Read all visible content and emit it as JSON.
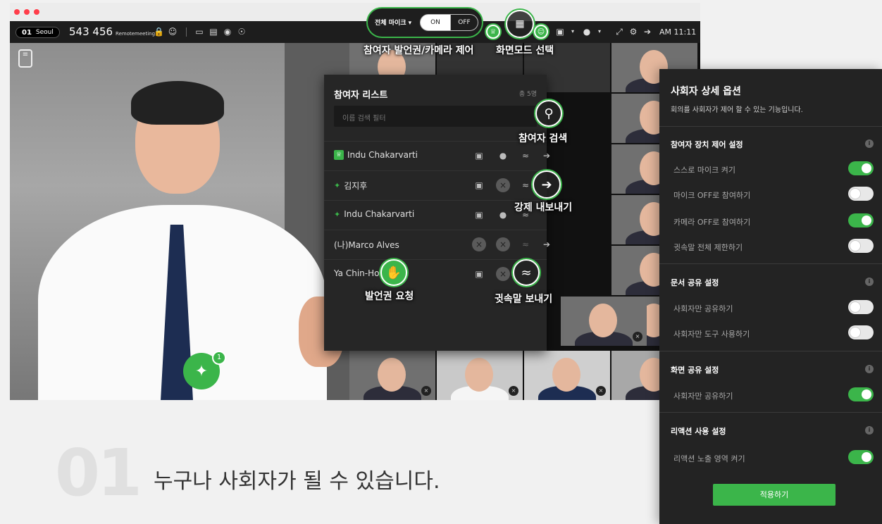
{
  "topbar": {
    "location_num": "01",
    "location": "Seoul",
    "room_id": "543 456",
    "room_name": "Remotemeeting",
    "time": "AM 11:11"
  },
  "mic_control": {
    "label": "전체 마이크 ▾",
    "on": "ON",
    "off": "OFF"
  },
  "participants_panel": {
    "title": "참여자 리스트",
    "count": "총 5명",
    "search_placeholder": "이름 검색 필터",
    "rows": [
      {
        "name": "Indu Chakarvarti",
        "role": "host"
      },
      {
        "name": "김지후",
        "role": "pinned"
      },
      {
        "name": "Indu Chakarvarti",
        "role": "pinned"
      },
      {
        "name": "(나)Marco Alves",
        "role": "self"
      },
      {
        "name": "Ya Chin-Ho",
        "role": "member"
      }
    ]
  },
  "callouts": {
    "participant_control": "참여자 발언권/카메라 제어",
    "screen_mode": "화면모드 선택",
    "search": "참여자 검색",
    "kick": "강제 내보내기",
    "speak_request": "발언권 요청",
    "whisper": "귓속말 보내기"
  },
  "pin_badge_count": "1",
  "host_options": {
    "title": "사회자 상세 옵션",
    "description": "회의를 사회자가 제어 할 수 있는 기능입니다.",
    "sections": [
      {
        "title": "참여자 장치 제어 설정",
        "options": [
          {
            "label": "스스로 마이크 켜기",
            "on": true
          },
          {
            "label": "마이크 OFF로 참여하기",
            "on": false
          },
          {
            "label": "카메라 OFF로 참여하기",
            "on": true
          },
          {
            "label": "귓속말 전체 제한하기",
            "on": false
          }
        ]
      },
      {
        "title": "문서 공유 설정",
        "options": [
          {
            "label": "사회자만 공유하기",
            "on": false
          },
          {
            "label": "사회자만 도구 사용하기",
            "on": false
          }
        ]
      },
      {
        "title": "화면 공유 설정",
        "options": [
          {
            "label": "사회자만 공유하기",
            "on": true
          }
        ]
      },
      {
        "title": "리액션 사용 설정",
        "options": [
          {
            "label": "리액션 노출 영역 켜기",
            "on": true
          }
        ]
      }
    ],
    "apply_label": "적용하기"
  },
  "headline": {
    "number": "01",
    "text": "누구나 사회자가 될 수 있습니다."
  },
  "colors": {
    "accent": "#3bb54a",
    "panel": "#232323",
    "topbar": "#1d1d1d"
  }
}
